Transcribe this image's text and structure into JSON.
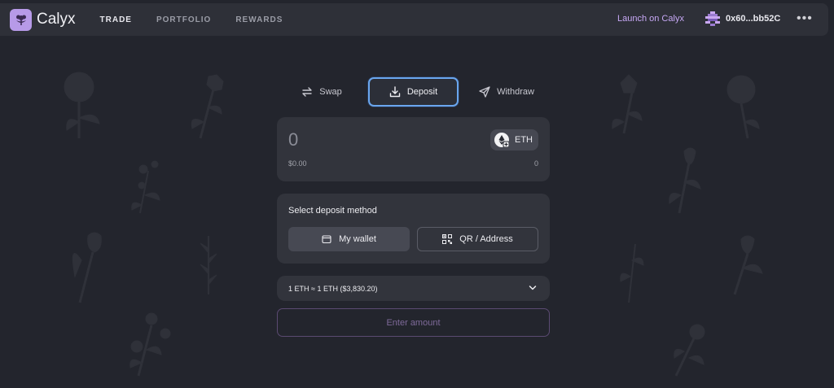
{
  "app": {
    "name": "Calyx"
  },
  "nav": {
    "items": [
      {
        "label": "TRADE",
        "active": true
      },
      {
        "label": "PORTFOLIO",
        "active": false
      },
      {
        "label": "REWARDS",
        "active": false
      }
    ],
    "launch_label": "Launch on Calyx",
    "account_address": "0x60...bb52C",
    "more_label": "•••"
  },
  "tabs": {
    "swap": "Swap",
    "deposit": "Deposit",
    "withdraw": "Withdraw",
    "selected": "Deposit"
  },
  "amount": {
    "value": "0",
    "usd_value": "$0.00",
    "balance": "0",
    "token_symbol": "ETH"
  },
  "deposit_method": {
    "title": "Select deposit method",
    "wallet_label": "My wallet",
    "qr_label": "QR / Address"
  },
  "rate": {
    "text": "1 ETH ≈ 1 ETH ($3,830.20)"
  },
  "submit": {
    "label": "Enter amount"
  },
  "colors": {
    "accent_purple": "#b79ae8",
    "launch_text": "#c7a8f5",
    "selected_tab_border": "#6aa6ee",
    "background": "#23252d",
    "card": "#32343c"
  },
  "icons": {
    "logo": "flower-logo-icon",
    "account": "pixel-avatar-icon",
    "swap": "swap-arrows-icon",
    "deposit": "download-icon",
    "withdraw": "send-icon",
    "token": "eth-icon",
    "wallet": "wallet-icon",
    "qr": "qr-code-icon",
    "chevron": "chevron-down-icon"
  }
}
